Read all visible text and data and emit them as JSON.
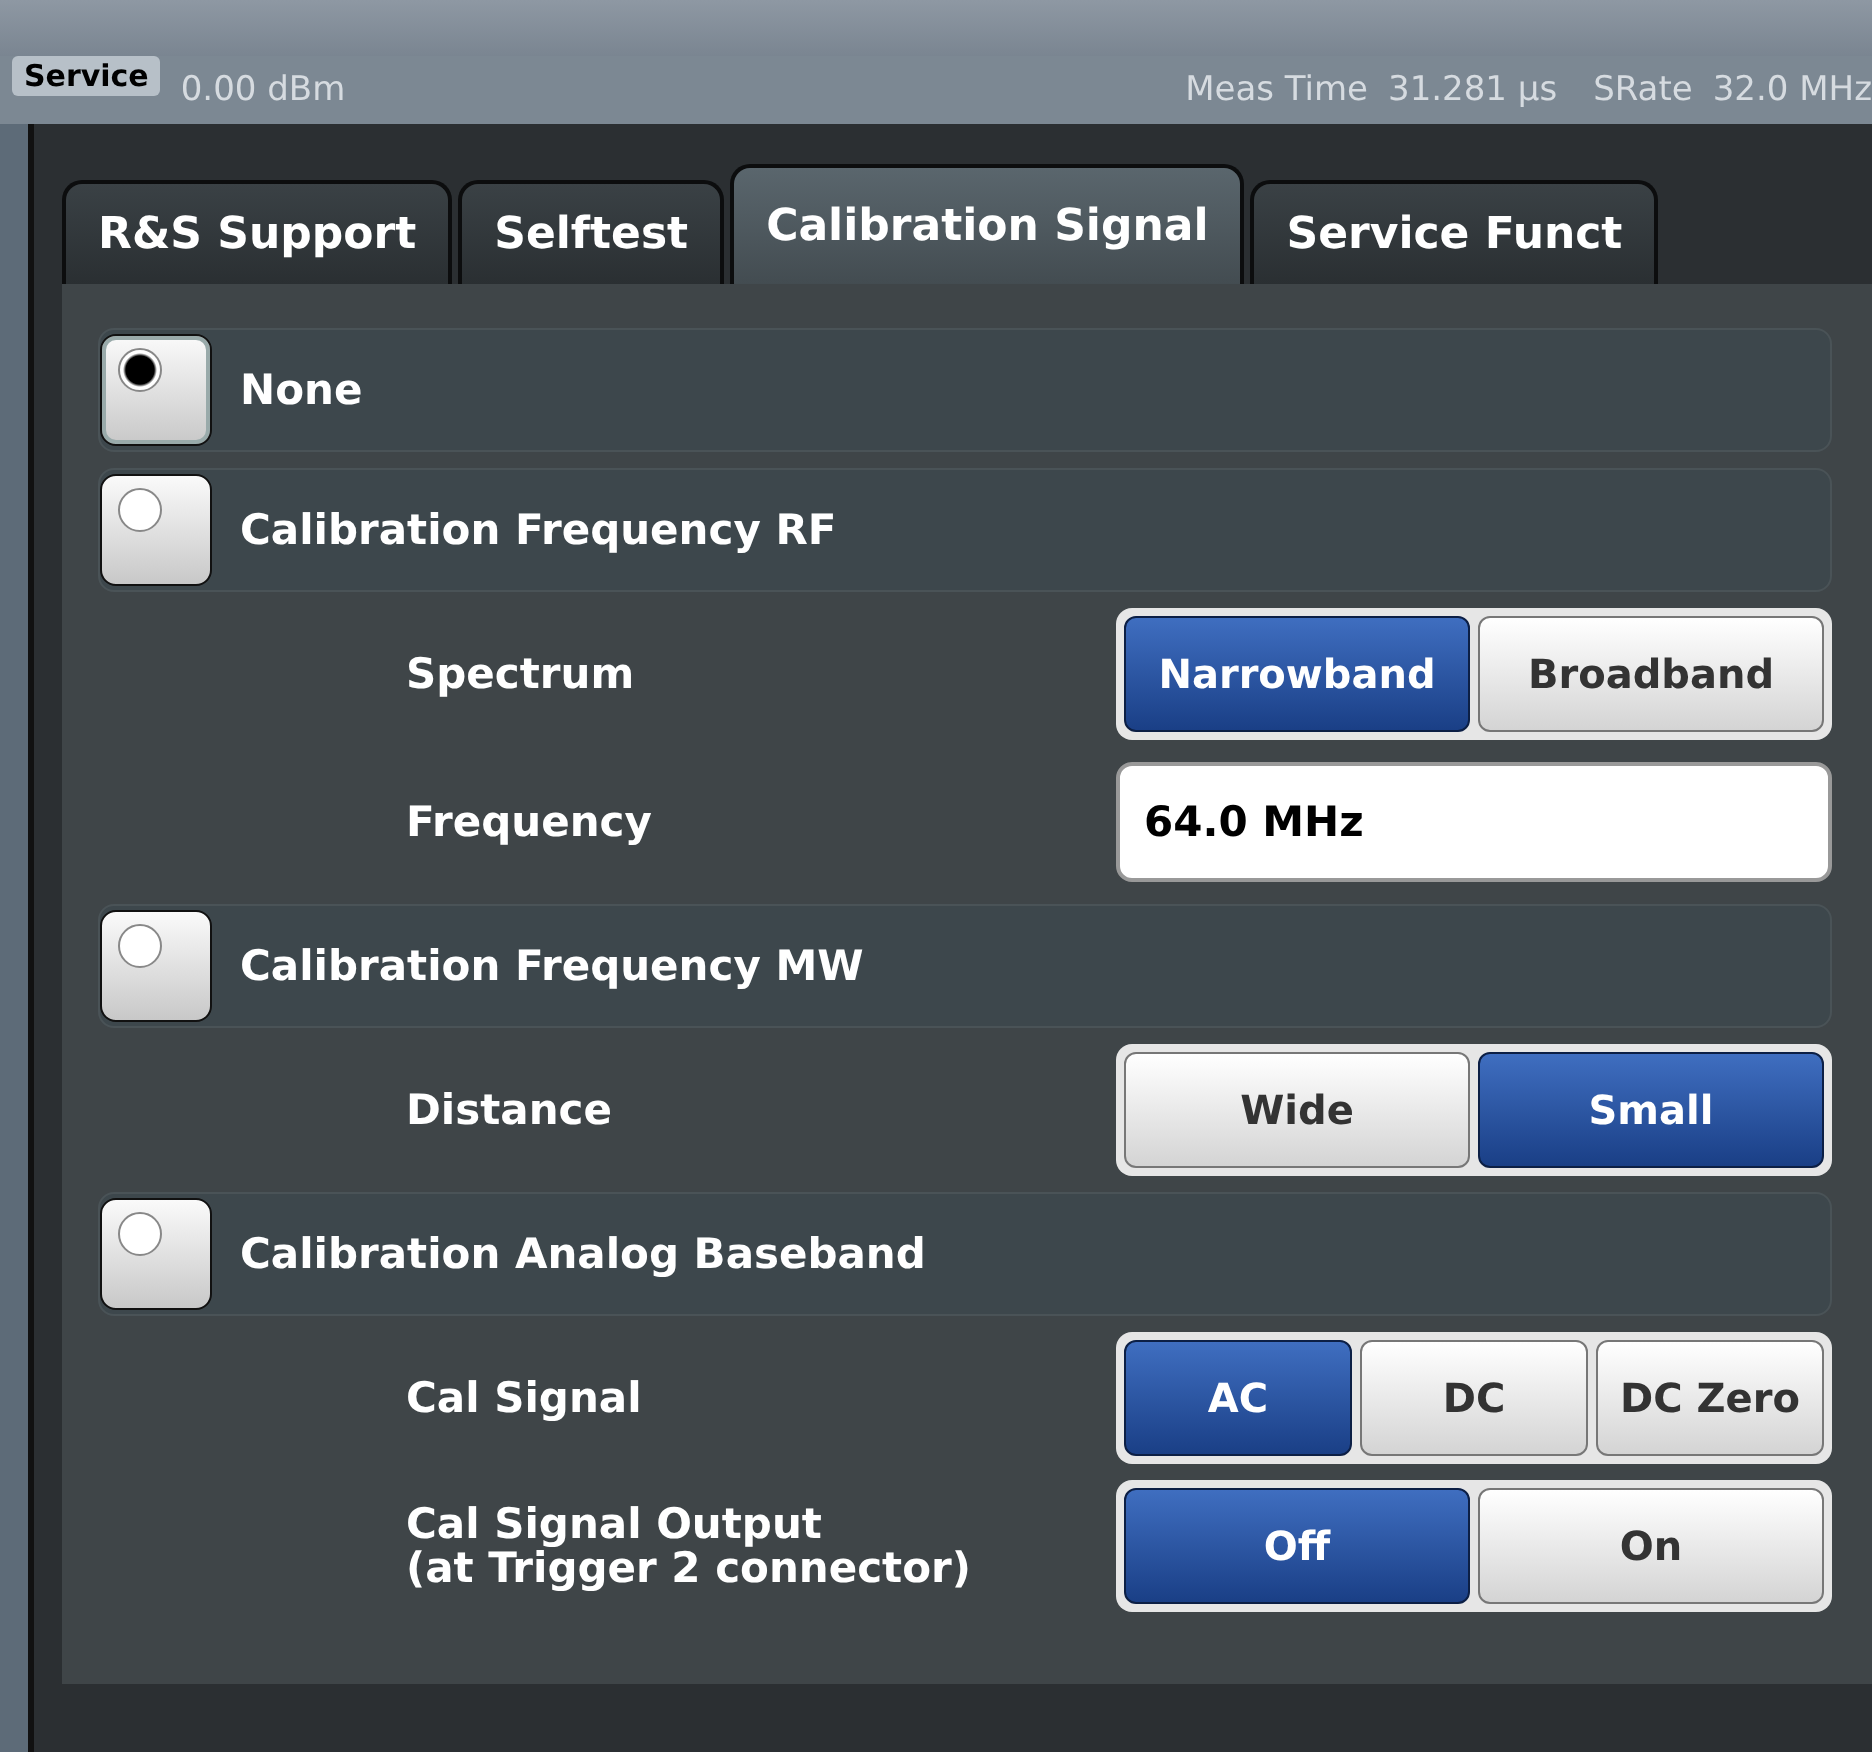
{
  "dialog_title": "Service",
  "status": {
    "ref_level_value": "0.00 dBm",
    "meas_time_label": "Meas Time",
    "meas_time_value": "31.281 µs",
    "srate_label": "SRate",
    "srate_value": "32.0 MHz"
  },
  "tabs": [
    {
      "label": "R&S Support",
      "selected": false
    },
    {
      "label": "Selftest",
      "selected": false
    },
    {
      "label": "Calibration Signal",
      "selected": true
    },
    {
      "label": "Service Funct",
      "selected": false
    }
  ],
  "options": [
    {
      "label": "None",
      "selected": true
    },
    {
      "label": "Calibration Frequency RF",
      "selected": false,
      "settings": [
        {
          "kind": "toggle",
          "label": "Spectrum",
          "buttons": [
            {
              "label": "Narrowband",
              "selected": true
            },
            {
              "label": "Broadband",
              "selected": false
            }
          ]
        },
        {
          "kind": "field",
          "label": "Frequency",
          "value": "64.0 MHz"
        }
      ]
    },
    {
      "label": "Calibration Frequency MW",
      "selected": false,
      "settings": [
        {
          "kind": "toggle",
          "label": "Distance",
          "buttons": [
            {
              "label": "Wide",
              "selected": false
            },
            {
              "label": "Small",
              "selected": true
            }
          ]
        }
      ]
    },
    {
      "label": "Calibration Analog Baseband",
      "selected": false,
      "settings": [
        {
          "kind": "toggle",
          "label": "Cal Signal",
          "buttons": [
            {
              "label": "AC",
              "selected": true
            },
            {
              "label": "DC",
              "selected": false
            },
            {
              "label": "DC Zero",
              "selected": false
            }
          ]
        },
        {
          "kind": "toggle",
          "label": "Cal Signal Output\n(at Trigger 2 connector)",
          "buttons": [
            {
              "label": "Off",
              "selected": true
            },
            {
              "label": "On",
              "selected": false
            }
          ]
        }
      ]
    }
  ]
}
